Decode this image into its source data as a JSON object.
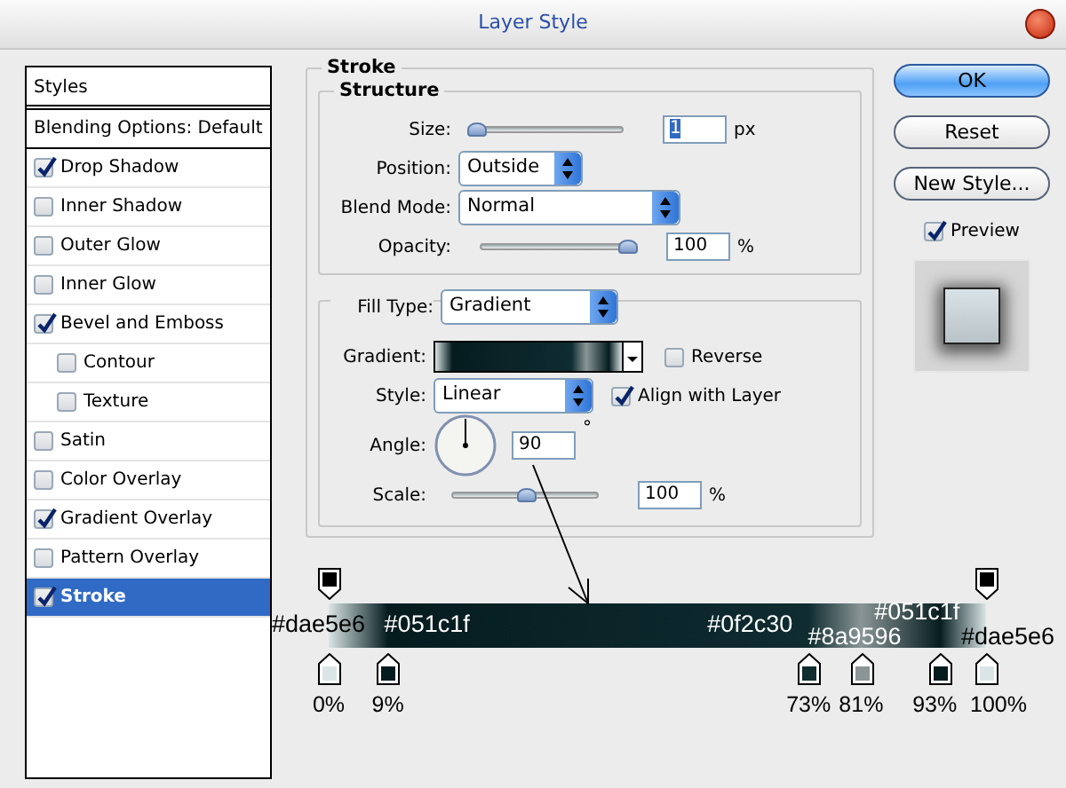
{
  "window": {
    "title": "Layer Style"
  },
  "sidebar": {
    "header": "Styles",
    "items": [
      {
        "label": "Blending Options: Default",
        "kind": "plain",
        "selected": false
      },
      {
        "label": "Drop Shadow",
        "kind": "check",
        "checked": true,
        "selected": false
      },
      {
        "label": "Inner Shadow",
        "kind": "check",
        "checked": false,
        "selected": false
      },
      {
        "label": "Outer Glow",
        "kind": "check",
        "checked": false,
        "selected": false
      },
      {
        "label": "Inner Glow",
        "kind": "check",
        "checked": false,
        "selected": false
      },
      {
        "label": "Bevel and Emboss",
        "kind": "check",
        "checked": true,
        "selected": false,
        "children": [
          {
            "label": "Contour",
            "kind": "check",
            "checked": false,
            "selected": false
          },
          {
            "label": "Texture",
            "kind": "check",
            "checked": false,
            "selected": false
          }
        ]
      },
      {
        "label": "Satin",
        "kind": "check",
        "checked": false,
        "selected": false
      },
      {
        "label": "Color Overlay",
        "kind": "check",
        "checked": false,
        "selected": false
      },
      {
        "label": "Gradient Overlay",
        "kind": "check",
        "checked": true,
        "selected": false
      },
      {
        "label": "Pattern Overlay",
        "kind": "check",
        "checked": false,
        "selected": false
      },
      {
        "label": "Stroke",
        "kind": "check",
        "checked": true,
        "selected": true
      }
    ]
  },
  "stroke": {
    "title": "Stroke",
    "structure": {
      "title": "Structure",
      "size": {
        "label": "Size:",
        "value": "1",
        "unit": "px",
        "level": 0.0
      },
      "position": {
        "label": "Position:",
        "value": "Outside"
      },
      "blend_mode": {
        "label": "Blend Mode:",
        "value": "Normal"
      },
      "opacity": {
        "label": "Opacity:",
        "value": "100",
        "unit": "%",
        "level": 1.0
      }
    },
    "fill_type": {
      "label": "Fill Type:",
      "value": "Gradient"
    },
    "gradient": {
      "label": "Gradient:"
    },
    "reverse": {
      "label": "Reverse",
      "checked": false
    },
    "style": {
      "label": "Style:",
      "value": "Linear"
    },
    "align": {
      "label": "Align with Layer",
      "checked": true
    },
    "angle": {
      "label": "Angle:",
      "value": "90",
      "unit": "°"
    },
    "scale": {
      "label": "Scale:",
      "value": "100",
      "unit": "%",
      "level": 0.5
    }
  },
  "buttons": [
    {
      "label": "OK",
      "kind": "default"
    },
    {
      "label": "Reset",
      "kind": "normal"
    },
    {
      "label": "New Style...",
      "kind": "normal"
    }
  ],
  "preview": {
    "label": "Preview",
    "checked": true
  },
  "gradient_stops": [
    {
      "hex": "#dae5e6",
      "color": "#dae5e6",
      "location": "0%"
    },
    {
      "hex": "#051c1f",
      "color": "#051c1f",
      "location": "9%"
    },
    {
      "hex": "#0f2c30",
      "color": "#0f2c30",
      "location": "73%"
    },
    {
      "hex": "#8a9596",
      "color": "#8a9596",
      "location": "81%"
    },
    {
      "hex": "#051c1f",
      "color": "#051c1f",
      "location": "93%"
    },
    {
      "hex": "#dae5e6",
      "color": "#dae5e6",
      "location": "100%"
    }
  ]
}
